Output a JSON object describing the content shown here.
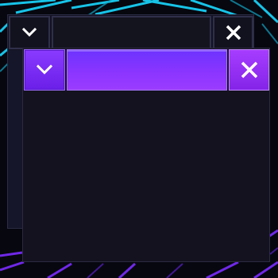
{
  "background": {
    "name": "neon-grid-wallpaper",
    "colors": {
      "cyan": "#19d8ff",
      "teal": "#11a6c6",
      "purple": "#7b2cff",
      "dark": "#07070f"
    }
  },
  "back_window": {
    "title": "",
    "minimize_icon": "chevron-down-icon",
    "close_icon": "close-icon",
    "state": "inactive"
  },
  "front_window": {
    "title": "",
    "minimize_icon": "chevron-down-icon",
    "close_icon": "close-icon",
    "state": "active",
    "colors": {
      "accent": "#8a35ff",
      "titlebar_gradient_start": "#6d33ff",
      "titlebar_gradient_end": "#9b3cff",
      "body": "#14121f"
    }
  }
}
